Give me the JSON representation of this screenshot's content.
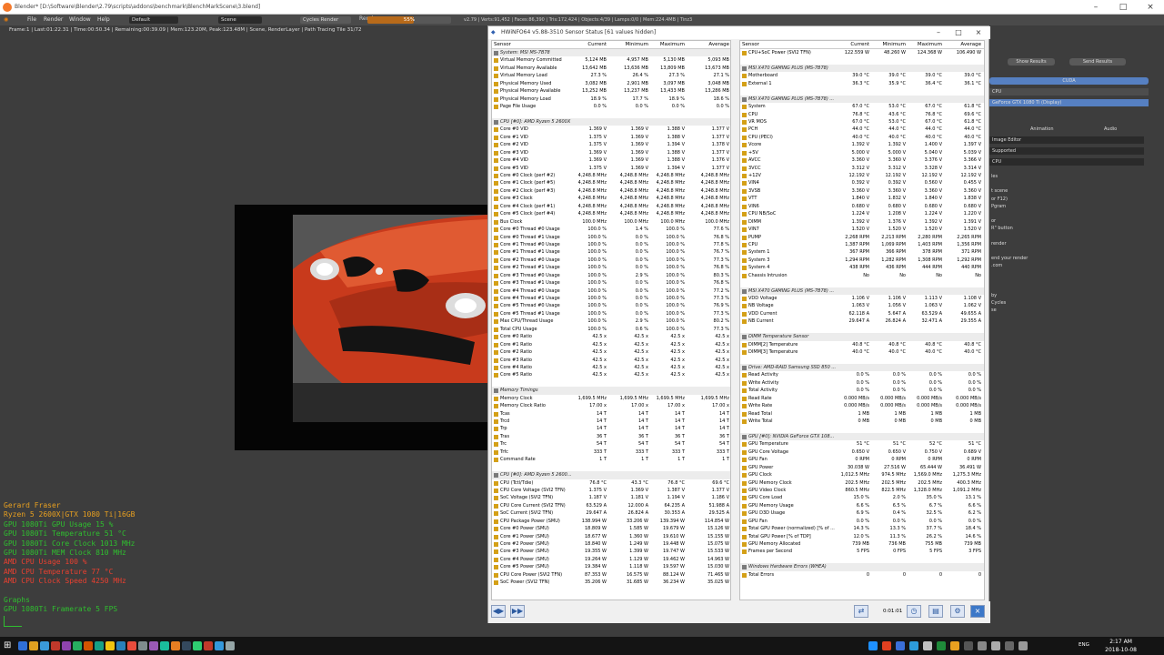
{
  "blender": {
    "title": "Blender* [D:\\Software\\Blender\\2.79\\scripts\\addons\\benchmark\\BlenchMarkScene\\3.blend]",
    "menus": [
      "File",
      "Render",
      "Window",
      "Help"
    ],
    "layout": "Default",
    "scene": "Scene",
    "engine": "Cycles Render",
    "render_tab": "Render",
    "progress": "55%",
    "progress_value": 55,
    "stats": "v2.79 | Verts:91,452 | Faces:86,390 | Tris:172,424 | Objects:4/39 | Lamps:0/0 | Mem:224.4MB | Tinz3",
    "render_info": "Frame:1 | Last:01:22.31 | Time:00:50.34 | Remaining:00:39.09 | Mem:123.20M, Peak:123.48M | Scene, RenderLayer | Path Tracing Tile 31/72",
    "right_panel": {
      "show_results": "Show Results",
      "send_results": "Send Results",
      "cuda": "CUDA",
      "cpu": "CPU",
      "gpu": "GeForce GTX 1080 Ti (Display)",
      "animation": "Animation",
      "audio": "Audio",
      "image_editor": "Image Editor",
      "supported": "Supported",
      "cpu2": "CPU",
      "text_lines": [
        "les",
        "",
        "t scene",
        "or F12)",
        "Pgram",
        "",
        "or",
        "R\" button",
        "",
        "render",
        "",
        "end your render",
        ".com",
        "",
        "",
        "",
        "by",
        "Cycles",
        "se"
      ]
    }
  },
  "overlay": [
    {
      "text": "Gerard Fraser",
      "color": "#e8a020"
    },
    {
      "text": "Ryzen 5 2600X|GTX 1080 Ti|16GB",
      "color": "#e8a020"
    },
    {
      "text": "GPU 1080Ti GPU Usage     15 %",
      "color": "#2fbf2f"
    },
    {
      "text": "GPU 1080Ti Temperature   51 °C",
      "color": "#2fbf2f"
    },
    {
      "text": "GPU 1080Ti Core Clock 1013 MHz",
      "color": "#2fbf2f"
    },
    {
      "text": "GPU 1080Ti MEM  Clock   810 MHz",
      "color": "#2fbf2f"
    },
    {
      "text": "AMD CPU Usage          100 %",
      "color": "#e84030"
    },
    {
      "text": "AMD CPU Temperature     77 °C",
      "color": "#e84030"
    },
    {
      "text": "AMD CPU Clock Speed   4250 MHz",
      "color": "#e84030"
    },
    {
      "text": "",
      "color": "#e84030"
    },
    {
      "text": "Graphs",
      "color": "#2fbf2f"
    },
    {
      "text": "GPU 1080Ti Framerate          5 FPS",
      "color": "#2fbf2f"
    }
  ],
  "hwinfo": {
    "title": "HWiNFO64 v5.88-3510 Sensor Status [61 values hidden]",
    "headers": [
      "Sensor",
      "Current",
      "Minimum",
      "Maximum",
      "Average"
    ],
    "left": [
      [
        "System: MSI MS-7B78",
        "",
        "",
        "",
        "",
        1
      ],
      [
        "Virtual Memory Committed",
        "5,124 MB",
        "4,957 MB",
        "5,130 MB",
        "5,093 MB"
      ],
      [
        "Virtual Memory Available",
        "13,642 MB",
        "13,636 MB",
        "13,809 MB",
        "13,673 MB"
      ],
      [
        "Virtual Memory Load",
        "27.3 %",
        "26.4 %",
        "27.3 %",
        "27.1 %"
      ],
      [
        "Physical Memory Used",
        "3,082 MB",
        "2,901 MB",
        "3,097 MB",
        "3,048 MB"
      ],
      [
        "Physical Memory Available",
        "13,252 MB",
        "13,237 MB",
        "13,433 MB",
        "13,286 MB"
      ],
      [
        "Physical Memory Load",
        "18.9 %",
        "17.7 %",
        "18.9 %",
        "18.6 %"
      ],
      [
        "Page File Usage",
        "0.0 %",
        "0.0 %",
        "0.0 %",
        "0.0 %"
      ],
      [
        "",
        "",
        "",
        "",
        "",
        2
      ],
      [
        "CPU [#0]: AMD Ryzen 5 2600X",
        "",
        "",
        "",
        "",
        1
      ],
      [
        "Core #0 VID",
        "1.369 V",
        "1.369 V",
        "1.388 V",
        "1.377 V"
      ],
      [
        "Core #1 VID",
        "1.375 V",
        "1.369 V",
        "1.388 V",
        "1.377 V"
      ],
      [
        "Core #2 VID",
        "1.375 V",
        "1.369 V",
        "1.394 V",
        "1.378 V"
      ],
      [
        "Core #3 VID",
        "1.369 V",
        "1.369 V",
        "1.388 V",
        "1.377 V"
      ],
      [
        "Core #4 VID",
        "1.369 V",
        "1.369 V",
        "1.388 V",
        "1.376 V"
      ],
      [
        "Core #5 VID",
        "1.375 V",
        "1.369 V",
        "1.394 V",
        "1.377 V"
      ],
      [
        "Core #0 Clock (perf #2)",
        "4,248.8 MHz",
        "4,248.8 MHz",
        "4,248.8 MHz",
        "4,248.8 MHz"
      ],
      [
        "Core #1 Clock (perf #5)",
        "4,248.8 MHz",
        "4,248.8 MHz",
        "4,248.8 MHz",
        "4,248.8 MHz"
      ],
      [
        "Core #2 Clock (perf #3)",
        "4,248.8 MHz",
        "4,248.8 MHz",
        "4,248.8 MHz",
        "4,248.8 MHz"
      ],
      [
        "Core #3 Clock",
        "4,248.8 MHz",
        "4,248.8 MHz",
        "4,248.8 MHz",
        "4,248.8 MHz"
      ],
      [
        "Core #4 Clock (perf #1)",
        "4,248.8 MHz",
        "4,248.8 MHz",
        "4,248.8 MHz",
        "4,248.8 MHz"
      ],
      [
        "Core #5 Clock (perf #4)",
        "4,248.8 MHz",
        "4,248.8 MHz",
        "4,248.8 MHz",
        "4,248.8 MHz"
      ],
      [
        "Bus Clock",
        "100.0 MHz",
        "100.0 MHz",
        "100.0 MHz",
        "100.0 MHz"
      ],
      [
        "Core #0 Thread #0 Usage",
        "100.0 %",
        "1.4 %",
        "100.0 %",
        "77.6 %"
      ],
      [
        "Core #0 Thread #1 Usage",
        "100.0 %",
        "0.0 %",
        "100.0 %",
        "76.8 %"
      ],
      [
        "Core #1 Thread #0 Usage",
        "100.0 %",
        "0.0 %",
        "100.0 %",
        "77.8 %"
      ],
      [
        "Core #1 Thread #1 Usage",
        "100.0 %",
        "0.0 %",
        "100.0 %",
        "76.7 %"
      ],
      [
        "Core #2 Thread #0 Usage",
        "100.0 %",
        "0.0 %",
        "100.0 %",
        "77.3 %"
      ],
      [
        "Core #2 Thread #1 Usage",
        "100.0 %",
        "0.0 %",
        "100.0 %",
        "76.8 %"
      ],
      [
        "Core #3 Thread #0 Usage",
        "100.0 %",
        "2.9 %",
        "100.0 %",
        "80.3 %"
      ],
      [
        "Core #3 Thread #1 Usage",
        "100.0 %",
        "0.0 %",
        "100.0 %",
        "76.8 %"
      ],
      [
        "Core #4 Thread #0 Usage",
        "100.0 %",
        "0.0 %",
        "100.0 %",
        "77.2 %"
      ],
      [
        "Core #4 Thread #1 Usage",
        "100.0 %",
        "0.0 %",
        "100.0 %",
        "77.3 %"
      ],
      [
        "Core #5 Thread #0 Usage",
        "100.0 %",
        "0.0 %",
        "100.0 %",
        "76.9 %"
      ],
      [
        "Core #5 Thread #1 Usage",
        "100.0 %",
        "0.0 %",
        "100.0 %",
        "77.3 %"
      ],
      [
        "Max CPU/Thread Usage",
        "100.0 %",
        "2.9 %",
        "100.0 %",
        "80.2 %"
      ],
      [
        "Total CPU Usage",
        "100.0 %",
        "0.6 %",
        "100.0 %",
        "77.3 %"
      ],
      [
        "Core #0 Ratio",
        "42.5 x",
        "42.5 x",
        "42.5 x",
        "42.5 x"
      ],
      [
        "Core #1 Ratio",
        "42.5 x",
        "42.5 x",
        "42.5 x",
        "42.5 x"
      ],
      [
        "Core #2 Ratio",
        "42.5 x",
        "42.5 x",
        "42.5 x",
        "42.5 x"
      ],
      [
        "Core #3 Ratio",
        "42.5 x",
        "42.5 x",
        "42.5 x",
        "42.5 x"
      ],
      [
        "Core #4 Ratio",
        "42.5 x",
        "42.5 x",
        "42.5 x",
        "42.5 x"
      ],
      [
        "Core #5 Ratio",
        "42.5 x",
        "42.5 x",
        "42.5 x",
        "42.5 x"
      ],
      [
        "",
        "",
        "",
        "",
        "",
        2
      ],
      [
        "Memory Timings",
        "",
        "",
        "",
        "",
        1
      ],
      [
        "Memory Clock",
        "1,699.5 MHz",
        "1,699.5 MHz",
        "1,699.5 MHz",
        "1,699.5 MHz"
      ],
      [
        "Memory Clock Ratio",
        "17.00 x",
        "17.00 x",
        "17.00 x",
        "17.00 x"
      ],
      [
        "Tcas",
        "14 T",
        "14 T",
        "14 T",
        "14 T"
      ],
      [
        "Trcd",
        "14 T",
        "14 T",
        "14 T",
        "14 T"
      ],
      [
        "Trp",
        "14 T",
        "14 T",
        "14 T",
        "14 T"
      ],
      [
        "Tras",
        "36 T",
        "36 T",
        "36 T",
        "36 T"
      ],
      [
        "Trc",
        "54 T",
        "54 T",
        "54 T",
        "54 T"
      ],
      [
        "Trfc",
        "333 T",
        "333 T",
        "333 T",
        "333 T"
      ],
      [
        "Command Rate",
        "1 T",
        "1 T",
        "1 T",
        "1 T"
      ],
      [
        "",
        "",
        "",
        "",
        "",
        2
      ],
      [
        "CPU [#0]: AMD Ryzen 5 2600...",
        "",
        "",
        "",
        "",
        1
      ],
      [
        "CPU (Tctl/Tdie)",
        "76.8 °C",
        "43.3 °C",
        "76.8 °C",
        "69.6 °C"
      ],
      [
        "CPU Core Voltage (SVI2 TFN)",
        "1.375 V",
        "1.369 V",
        "1.387 V",
        "1.377 V"
      ],
      [
        "SoC Voltage (SVI2 TFN)",
        "1.187 V",
        "1.181 V",
        "1.194 V",
        "1.186 V"
      ],
      [
        "CPU Core Current (SVI2 TFN)",
        "63.529 A",
        "12.000 A",
        "64.235 A",
        "51.988 A"
      ],
      [
        "SoC Current (SVI2 TFN)",
        "29.647 A",
        "26.824 A",
        "30.353 A",
        "29.525 A"
      ],
      [
        "CPU Package Power (SMU)",
        "138.994 W",
        "33.206 W",
        "139.394 W",
        "114.854 W"
      ],
      [
        "Core #0 Power (SMU)",
        "18.809 W",
        "1.585 W",
        "19.679 W",
        "15.126 W"
      ],
      [
        "Core #1 Power (SMU)",
        "18.677 W",
        "1.360 W",
        "19.610 W",
        "15.155 W"
      ],
      [
        "Core #2 Power (SMU)",
        "18.840 W",
        "1.249 W",
        "19.448 W",
        "15.075 W"
      ],
      [
        "Core #3 Power (SMU)",
        "19.355 W",
        "1.399 W",
        "19.747 W",
        "15.533 W"
      ],
      [
        "Core #4 Power (SMU)",
        "19.264 W",
        "1.129 W",
        "19.462 W",
        "14.963 W"
      ],
      [
        "Core #5 Power (SMU)",
        "19.384 W",
        "1.118 W",
        "19.597 W",
        "15.030 W"
      ],
      [
        "CPU Core Power (SVI2 TFN)",
        "87.353 W",
        "16.575 W",
        "88.124 W",
        "71.465 W"
      ],
      [
        "SoC Power (SVI2 TFN)",
        "35.206 W",
        "31.685 W",
        "36.234 W",
        "35.025 W"
      ]
    ],
    "right": [
      [
        "CPU+SoC Power (SVI2 TFN)",
        "122.559 W",
        "48.260 W",
        "124.368 W",
        "106.490 W"
      ],
      [
        "",
        "",
        "",
        "",
        "",
        2
      ],
      [
        "MSI X470 GAMING PLUS (MS-7B78)",
        "",
        "",
        "",
        "",
        1
      ],
      [
        "Motherboard",
        "39.0 °C",
        "39.0 °C",
        "39.0 °C",
        "39.0 °C"
      ],
      [
        "External 1",
        "36.3 °C",
        "35.9 °C",
        "36.4 °C",
        "36.1 °C"
      ],
      [
        "",
        "",
        "",
        "",
        "",
        2
      ],
      [
        "MSI X470 GAMING PLUS (MS-7B78) ...",
        "",
        "",
        "",
        "",
        1
      ],
      [
        "System",
        "67.0 °C",
        "53.0 °C",
        "67.0 °C",
        "61.8 °C"
      ],
      [
        "CPU",
        "76.8 °C",
        "43.6 °C",
        "76.8 °C",
        "69.6 °C"
      ],
      [
        "VR MOS",
        "67.0 °C",
        "53.0 °C",
        "67.0 °C",
        "61.8 °C"
      ],
      [
        "PCH",
        "44.0 °C",
        "44.0 °C",
        "44.0 °C",
        "44.0 °C"
      ],
      [
        "CPU (PECI)",
        "40.0 °C",
        "40.0 °C",
        "40.0 °C",
        "40.0 °C"
      ],
      [
        "Vcore",
        "1.392 V",
        "1.392 V",
        "1.400 V",
        "1.397 V"
      ],
      [
        "+5V",
        "5.000 V",
        "5.000 V",
        "5.040 V",
        "5.039 V"
      ],
      [
        "AVCC",
        "3.360 V",
        "3.360 V",
        "3.376 V",
        "3.366 V"
      ],
      [
        "3VCC",
        "3.312 V",
        "3.312 V",
        "3.328 V",
        "3.314 V"
      ],
      [
        "+12V",
        "12.192 V",
        "12.192 V",
        "12.192 V",
        "12.192 V"
      ],
      [
        "VIN4",
        "0.392 V",
        "0.392 V",
        "0.560 V",
        "0.455 V"
      ],
      [
        "3VSB",
        "3.360 V",
        "3.360 V",
        "3.360 V",
        "3.360 V"
      ],
      [
        "VTT",
        "1.840 V",
        "1.832 V",
        "1.840 V",
        "1.838 V"
      ],
      [
        "VIN6",
        "0.680 V",
        "0.680 V",
        "0.680 V",
        "0.680 V"
      ],
      [
        "CPU NB/SoC",
        "1.224 V",
        "1.208 V",
        "1.224 V",
        "1.220 V"
      ],
      [
        "DIMM",
        "1.392 V",
        "1.376 V",
        "1.392 V",
        "1.391 V"
      ],
      [
        "VIN7",
        "1.520 V",
        "1.520 V",
        "1.520 V",
        "1.520 V"
      ],
      [
        "PUMP",
        "2,268 RPM",
        "2,213 RPM",
        "2,280 RPM",
        "2,265 RPM"
      ],
      [
        "CPU",
        "1,387 RPM",
        "1,069 RPM",
        "1,403 RPM",
        "1,356 RPM"
      ],
      [
        "System 1",
        "367 RPM",
        "366 RPM",
        "378 RPM",
        "371 RPM"
      ],
      [
        "System 3",
        "1,294 RPM",
        "1,282 RPM",
        "1,308 RPM",
        "1,292 RPM"
      ],
      [
        "System 4",
        "438 RPM",
        "436 RPM",
        "444 RPM",
        "440 RPM"
      ],
      [
        "Chassis Intrusion",
        "No",
        "No",
        "No",
        "No"
      ],
      [
        "",
        "",
        "",
        "",
        "",
        2
      ],
      [
        "MSI X470 GAMING PLUS (MS-7B78) ...",
        "",
        "",
        "",
        "",
        1
      ],
      [
        "VDD Voltage",
        "1.106 V",
        "1.106 V",
        "1.113 V",
        "1.108 V"
      ],
      [
        "NB Voltage",
        "1.063 V",
        "1.056 V",
        "1.063 V",
        "1.062 V"
      ],
      [
        "VDD Current",
        "62.118 A",
        "5.647 A",
        "63.529 A",
        "49.655 A"
      ],
      [
        "NB Current",
        "29.647 A",
        "26.824 A",
        "32.471 A",
        "29.355 A"
      ],
      [
        "",
        "",
        "",
        "",
        "",
        2
      ],
      [
        "DIMM Temperature Sensor",
        "",
        "",
        "",
        "",
        1
      ],
      [
        "DIMM[2] Temperature",
        "40.8 °C",
        "40.8 °C",
        "40.8 °C",
        "40.8 °C"
      ],
      [
        "DIMM[3] Temperature",
        "40.0 °C",
        "40.0 °C",
        "40.0 °C",
        "40.0 °C"
      ],
      [
        "",
        "",
        "",
        "",
        "",
        2
      ],
      [
        "Drive: AMD-RAID Samsung SSD 850 ...",
        "",
        "",
        "",
        "",
        1
      ],
      [
        "Read Activity",
        "0.0 %",
        "0.0 %",
        "0.0 %",
        "0.0 %"
      ],
      [
        "Write Activity",
        "0.0 %",
        "0.0 %",
        "0.0 %",
        "0.0 %"
      ],
      [
        "Total Activity",
        "0.0 %",
        "0.0 %",
        "0.0 %",
        "0.0 %"
      ],
      [
        "Read Rate",
        "0.000 MB/s",
        "0.000 MB/s",
        "0.000 MB/s",
        "0.000 MB/s"
      ],
      [
        "Write Rate",
        "0.000 MB/s",
        "0.000 MB/s",
        "0.000 MB/s",
        "0.000 MB/s"
      ],
      [
        "Read Total",
        "1 MB",
        "1 MB",
        "1 MB",
        "1 MB"
      ],
      [
        "Write Total",
        "0 MB",
        "0 MB",
        "0 MB",
        "0 MB"
      ],
      [
        "",
        "",
        "",
        "",
        "",
        2
      ],
      [
        "GPU [#0]: NVIDIA GeForce GTX 108...",
        "",
        "",
        "",
        "",
        1
      ],
      [
        "GPU Temperature",
        "51 °C",
        "51 °C",
        "52 °C",
        "51 °C"
      ],
      [
        "GPU Core Voltage",
        "0.650 V",
        "0.650 V",
        "0.750 V",
        "0.689 V"
      ],
      [
        "GPU Fan",
        "0 RPM",
        "0 RPM",
        "0 RPM",
        "0 RPM"
      ],
      [
        "GPU Power",
        "30.038 W",
        "27.516 W",
        "65.444 W",
        "36.491 W"
      ],
      [
        "GPU Clock",
        "1,012.5 MHz",
        "974.5 MHz",
        "1,569.0 MHz",
        "1,275.3 MHz"
      ],
      [
        "GPU Memory Clock",
        "202.5 MHz",
        "202.5 MHz",
        "202.5 MHz",
        "400.3 MHz"
      ],
      [
        "GPU Video Clock",
        "860.5 MHz",
        "822.5 MHz",
        "1,328.0 MHz",
        "1,091.2 MHz"
      ],
      [
        "GPU Core Load",
        "15.0 %",
        "2.0 %",
        "35.0 %",
        "13.1 %"
      ],
      [
        "GPU Memory Usage",
        "6.6 %",
        "6.5 %",
        "6.7 %",
        "6.6 %"
      ],
      [
        "GPU D3D Usage",
        "6.9 %",
        "0.4 %",
        "32.5 %",
        "6.2 %"
      ],
      [
        "GPU Fan",
        "0.0 %",
        "0.0 %",
        "0.0 %",
        "0.0 %"
      ],
      [
        "Total GPU Power (normalized) [% of ...",
        "14.3 %",
        "13.3 %",
        "37.7 %",
        "18.4 %"
      ],
      [
        "Total GPU Power [% of TDP]",
        "12.0 %",
        "11.3 %",
        "26.2 %",
        "14.6 %"
      ],
      [
        "GPU Memory Allocated",
        "739 MB",
        "736 MB",
        "755 MB",
        "739 MB"
      ],
      [
        "Frames per Second",
        "5 FPS",
        "0 FPS",
        "5 FPS",
        "3 FPS"
      ],
      [
        "",
        "",
        "",
        "",
        "",
        2
      ],
      [
        "Windows Hardware Errors (WHEA)",
        "",
        "",
        "",
        "",
        1
      ],
      [
        "Total Errors",
        "0",
        "0",
        "0",
        "0"
      ]
    ],
    "timer": "0:01:01"
  },
  "taskbar": {
    "time": "2:17 AM",
    "date": "2018-10-08",
    "lang": "ENG"
  }
}
